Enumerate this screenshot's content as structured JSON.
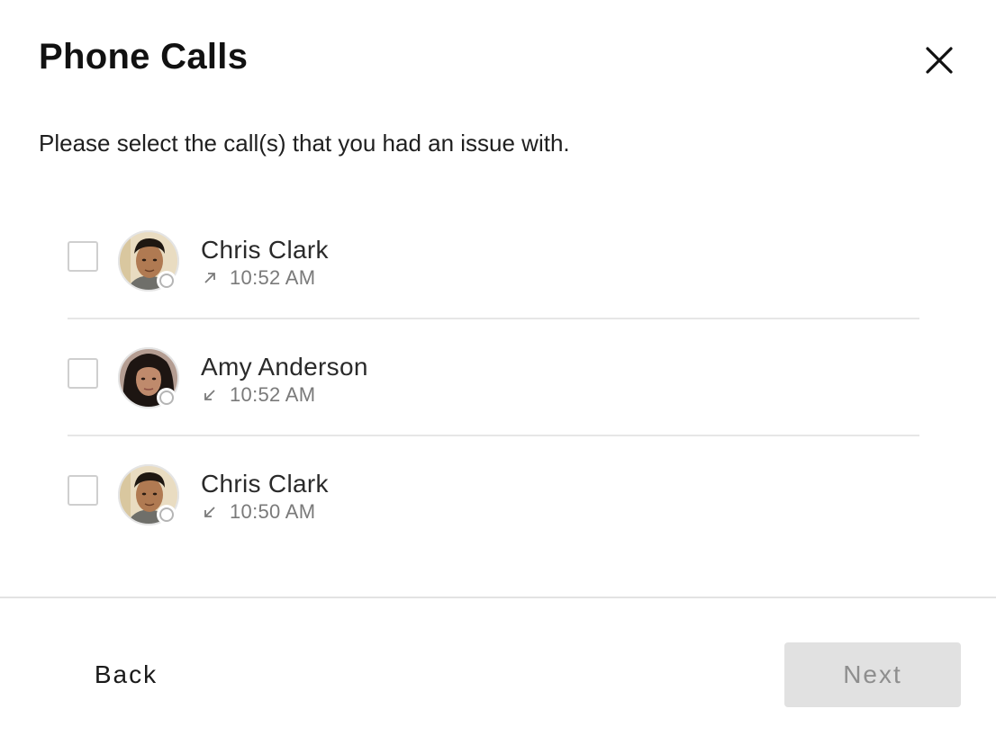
{
  "dialog": {
    "title": "Phone Calls",
    "close_icon": "close-icon",
    "instructions": "Please select the call(s) that you had an issue with."
  },
  "calls": [
    {
      "name": "Chris Clark",
      "time": "10:52 AM",
      "direction": "outgoing",
      "direction_icon": "arrow-up-right-icon",
      "checked": false,
      "avatar_icon": "avatar-chris-clark"
    },
    {
      "name": "Amy Anderson",
      "time": "10:52 AM",
      "direction": "incoming",
      "direction_icon": "arrow-down-left-icon",
      "checked": false,
      "avatar_icon": "avatar-amy-anderson"
    },
    {
      "name": "Chris Clark",
      "time": "10:50 AM",
      "direction": "incoming",
      "direction_icon": "arrow-down-left-icon",
      "checked": false,
      "avatar_icon": "avatar-chris-clark"
    }
  ],
  "footer": {
    "back_label": "Back",
    "next_label": "Next",
    "next_enabled": false
  },
  "colors": {
    "divider": "#e6e6e6",
    "next_disabled_bg": "#e1e1e1",
    "next_disabled_text": "#8e8e8e",
    "meta_text": "#7a7a7a",
    "status_ring": "#b5b5b5"
  }
}
